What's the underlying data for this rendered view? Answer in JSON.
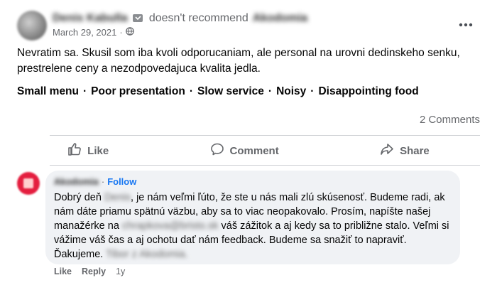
{
  "review": {
    "author_name": "Denis Kabulla",
    "verb": "doesn't recommend",
    "target_page": "Akodomia",
    "date": "March 29, 2021",
    "date_separator": "·",
    "text": "Nevratim sa. Skusil som iba kvoli odporucaniam, ale personal na urovni dedinskeho senku, prestrelene ceny a nezodpovedajuca kvalita jedla.",
    "tags": [
      "Small menu",
      "Poor presentation",
      "Slow service",
      "Noisy",
      "Disappointing food"
    ],
    "tag_separator": "·",
    "comments_count": "2 Comments"
  },
  "actions": {
    "like": "Like",
    "comment": "Comment",
    "share": "Share"
  },
  "comment": {
    "author": "Akodomia",
    "dot": "·",
    "follow": "Follow",
    "text_1": "Dobrý deň ",
    "redacted_name": "Denis",
    "text_2": ", je nám veľmi ľúto, že ste u nás mali zlú skúsenosť. Budeme radi, ak nám dáte priamu spätnú väzbu, aby sa to viac neopakovalo. Prosím, napíšte našej manažérke na ",
    "redacted_email": "chrapkova@bristo.sk",
    "text_3": " váš zážitok a aj kedy sa to približne stalo. Veľmi si vážime váš čas a aj ochotu dať nám feedback. Budeme sa snažiť to napraviť. Ďakujeme. ",
    "redacted_signature": "Tibor z Akodomia.",
    "like": "Like",
    "reply": "Reply",
    "time": "1y"
  },
  "icons": {
    "recommend": "flag-icon",
    "privacy": "globe-icon",
    "more": "more-horizontal-icon",
    "like": "thumbs-up-icon",
    "comment": "speech-bubble-icon",
    "share": "share-arrow-icon"
  },
  "colors": {
    "link_blue": "#1877f2",
    "secondary_text": "#65676b",
    "bubble_bg": "#f0f2f5",
    "commenter_avatar": "#e41e3f"
  }
}
